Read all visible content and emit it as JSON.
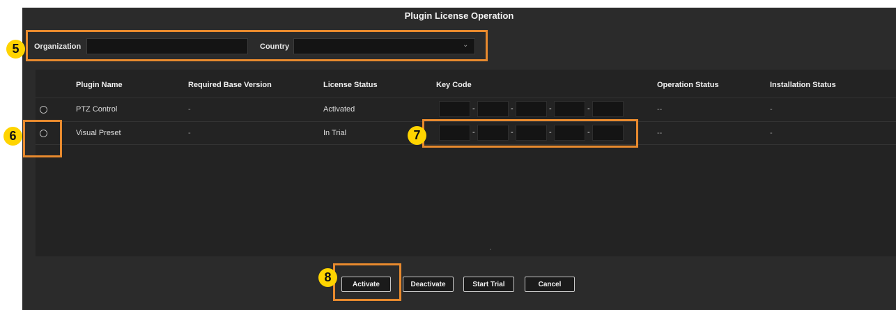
{
  "dialog": {
    "title": "Plugin License Operation"
  },
  "form": {
    "organization_label": "Organization",
    "organization_value": "",
    "country_label": "Country",
    "country_value": ""
  },
  "table": {
    "headers": [
      "Plugin Name",
      "Required Base Version",
      "License Status",
      "Key Code",
      "Operation Status",
      "Installation Status"
    ],
    "rows": [
      {
        "name": "PTZ Control",
        "base_version": "-",
        "license_status": "Activated",
        "operation_status": "--",
        "installation_status": "-"
      },
      {
        "name": "Visual Preset",
        "base_version": "-",
        "license_status": "In Trial",
        "operation_status": "--",
        "installation_status": "-"
      }
    ],
    "key_separator": "-"
  },
  "buttons": {
    "activate": "Activate",
    "deactivate": "Deactivate",
    "start_trial": "Start Trial",
    "cancel": "Cancel"
  },
  "annotations": {
    "badge_5": "5",
    "badge_6": "6",
    "badge_7": "7",
    "badge_8": "8",
    "highlight_color": "#e88a2e",
    "badge_color": "#ffd400"
  }
}
